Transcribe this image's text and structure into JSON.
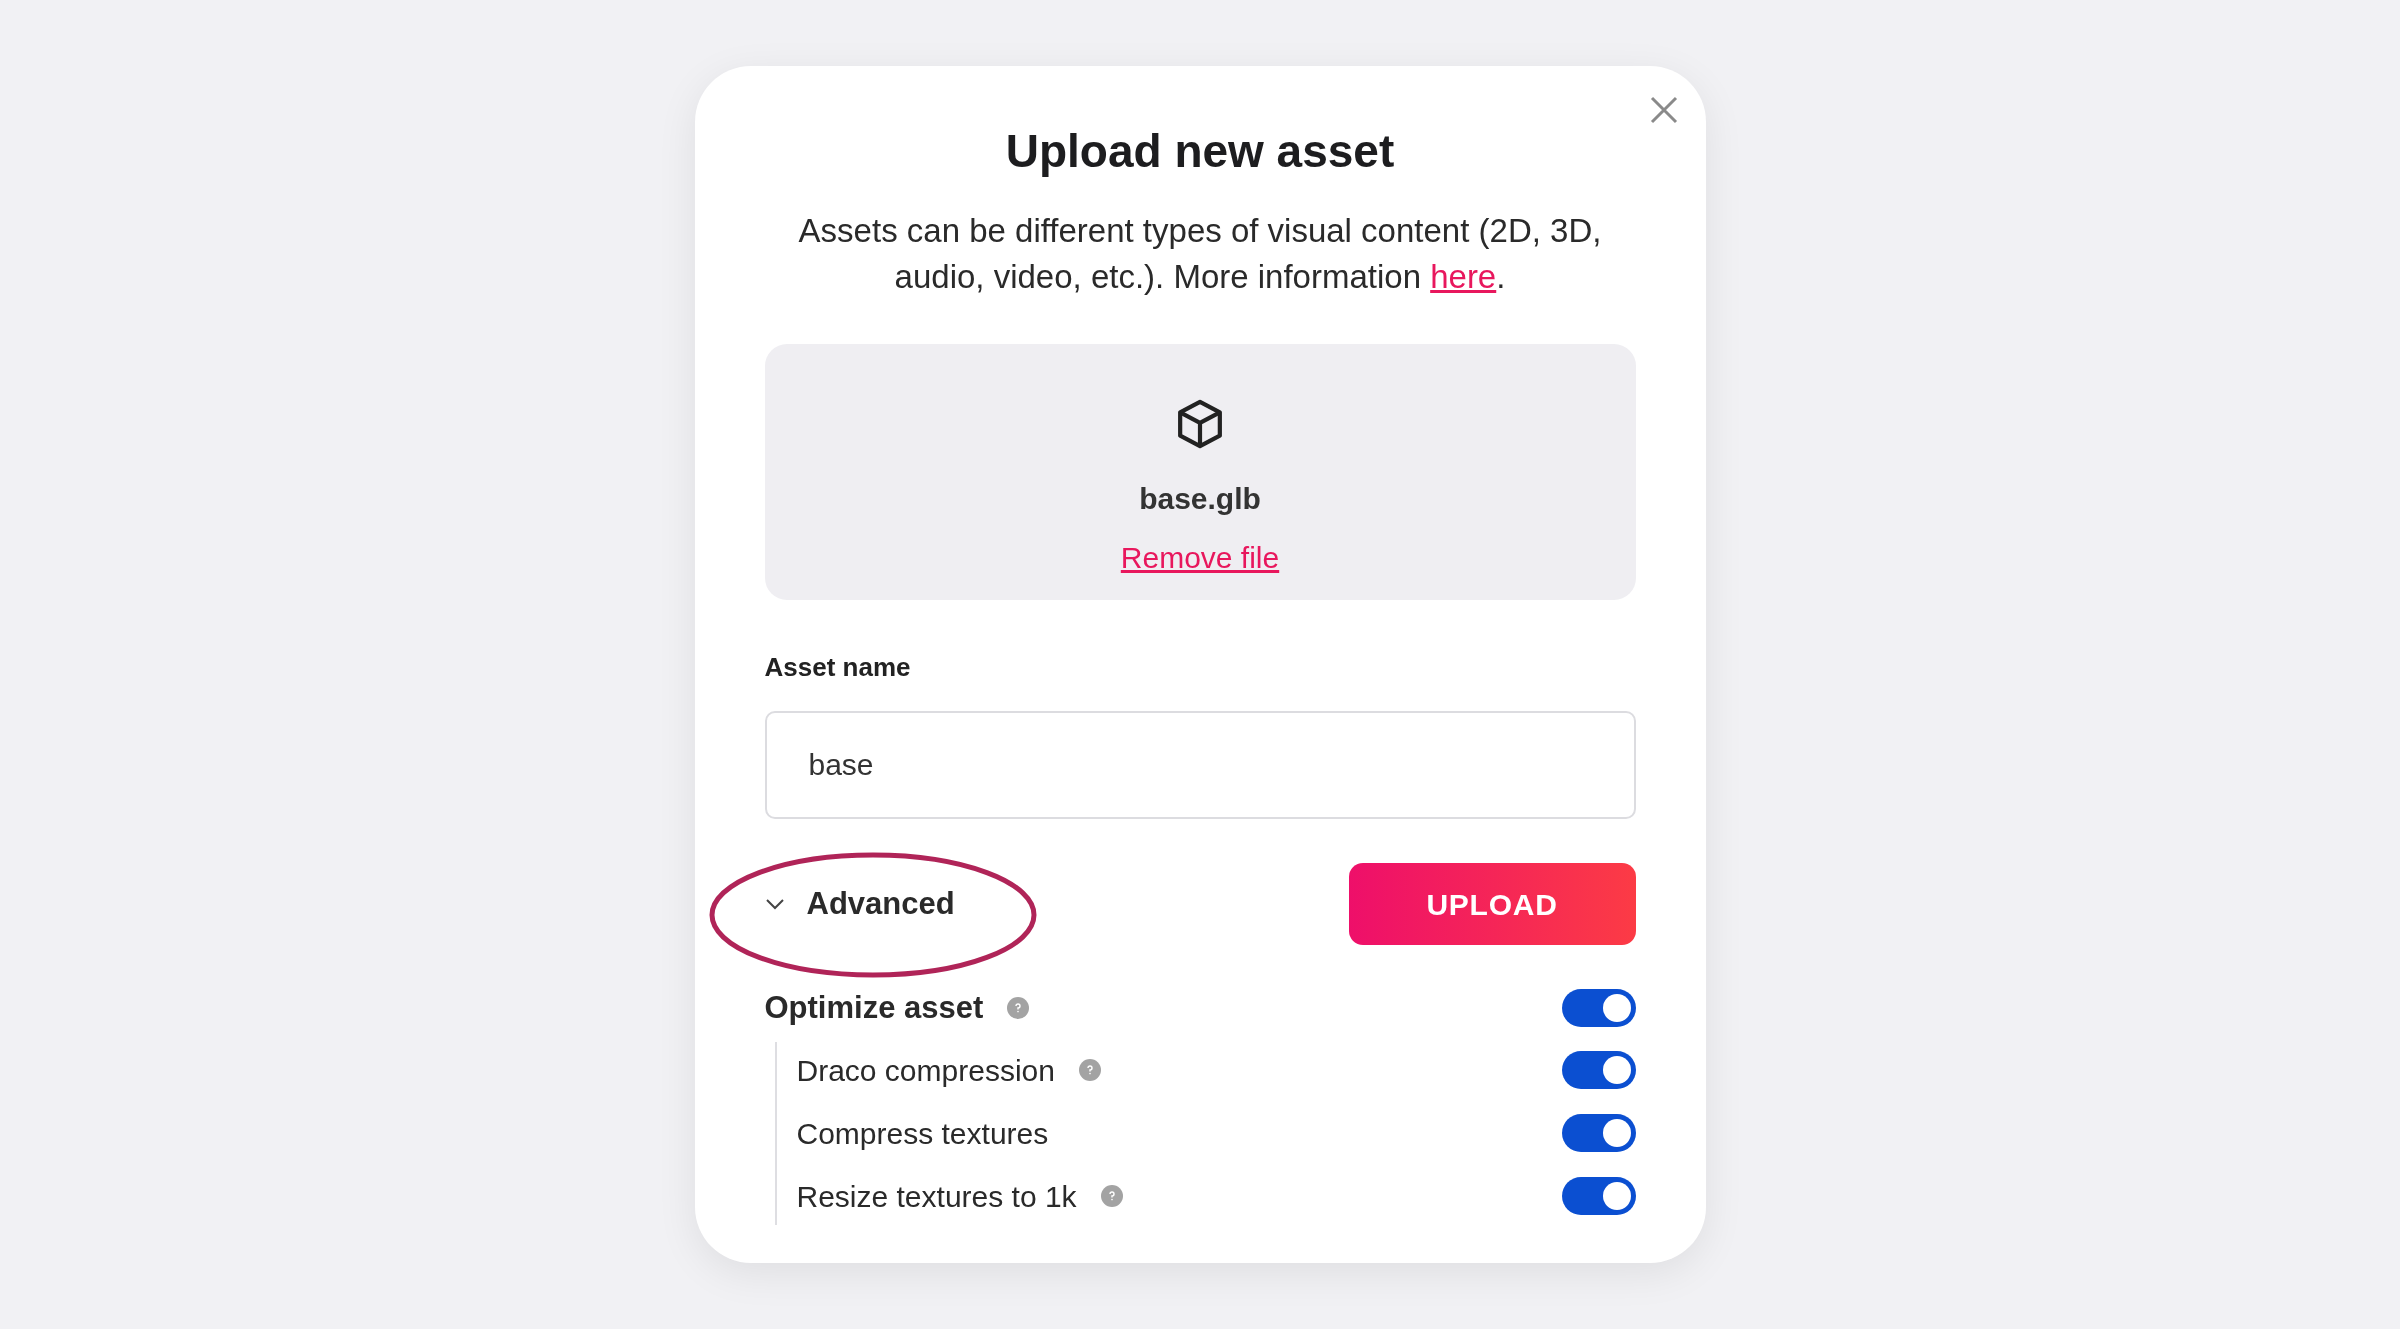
{
  "dialog": {
    "title": "Upload new asset",
    "description": "Assets can be different types of visual content (2D, 3D, audio, video, etc.). More information ",
    "link": "here",
    "link_after": "."
  },
  "file": {
    "name": "base.glb",
    "remove": "Remove file"
  },
  "asset_name": {
    "label": "Asset name",
    "value": "base"
  },
  "advanced": {
    "label": "Advanced",
    "expanded": true,
    "highlighted": true
  },
  "upload_button": "UPLOAD",
  "optimize": {
    "label": "Optimize asset",
    "help": true,
    "on": true,
    "children": [
      {
        "label": "Draco compression",
        "help": true,
        "on": true
      },
      {
        "label": "Compress textures",
        "help": false,
        "on": true
      },
      {
        "label": "Resize textures to 1k",
        "help": true,
        "on": true
      }
    ]
  }
}
